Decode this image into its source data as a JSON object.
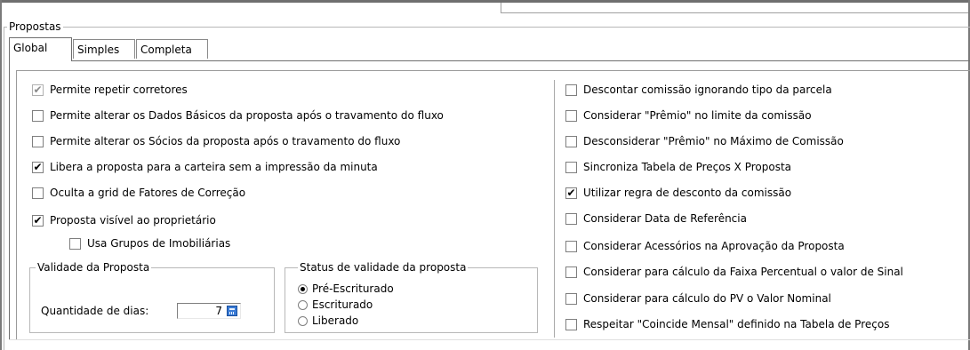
{
  "group_title": "Propostas",
  "tabs": [
    {
      "label": "Global",
      "active": true
    },
    {
      "label": "Simples",
      "active": false
    },
    {
      "label": "Completa",
      "active": false
    }
  ],
  "left_options": [
    {
      "label": "Permite repetir corretores",
      "checked": true,
      "disabled": true
    },
    {
      "label": "Permite alterar os Dados Básicos da proposta após o travamento do fluxo",
      "checked": false
    },
    {
      "label": "Permite alterar os Sócios da proposta após o travamento do fluxo",
      "checked": false
    },
    {
      "label": "Libera a proposta para a carteira sem a impressão da minuta",
      "checked": true
    },
    {
      "label": "Oculta a grid de Fatores de Correção",
      "checked": false
    },
    {
      "label": "Proposta visível ao proprietário",
      "checked": true
    },
    {
      "label": "Usa Grupos de Imobiliárias",
      "checked": false
    }
  ],
  "right_options": [
    {
      "label": "Descontar comissão ignorando tipo da parcela",
      "checked": false
    },
    {
      "label": "Considerar \"Prêmio\" no limite da comissão",
      "checked": false
    },
    {
      "label": "Desconsiderar \"Prêmio\" no Máximo de Comissão",
      "checked": false
    },
    {
      "label": "Sincroniza Tabela de Preços X Proposta",
      "checked": false
    },
    {
      "label": "Utilizar regra de desconto da comissão",
      "checked": true
    },
    {
      "label": "Considerar Data de Referência",
      "checked": false
    },
    {
      "label": "Considerar Acessórios na Aprovação da Proposta",
      "checked": false
    },
    {
      "label": "Considerar para cálculo da Faixa Percentual o valor de Sinal",
      "checked": false
    },
    {
      "label": "Considerar para cálculo do PV o Valor Nominal",
      "checked": false
    },
    {
      "label": "Respeitar \"Coincide Mensal\" definido na Tabela de Preços",
      "checked": false
    }
  ],
  "validade": {
    "title": "Validade da Proposta",
    "qty_label": "Quantidade de dias:",
    "qty_value": "7"
  },
  "status": {
    "title": "Status de validade da proposta",
    "options": [
      {
        "label": "Pré-Escriturado",
        "selected": true
      },
      {
        "label": "Escriturado",
        "selected": false
      },
      {
        "label": "Liberado",
        "selected": false
      }
    ]
  },
  "icons": {
    "check": "checkmark-icon",
    "calculator": "calculator-icon"
  }
}
